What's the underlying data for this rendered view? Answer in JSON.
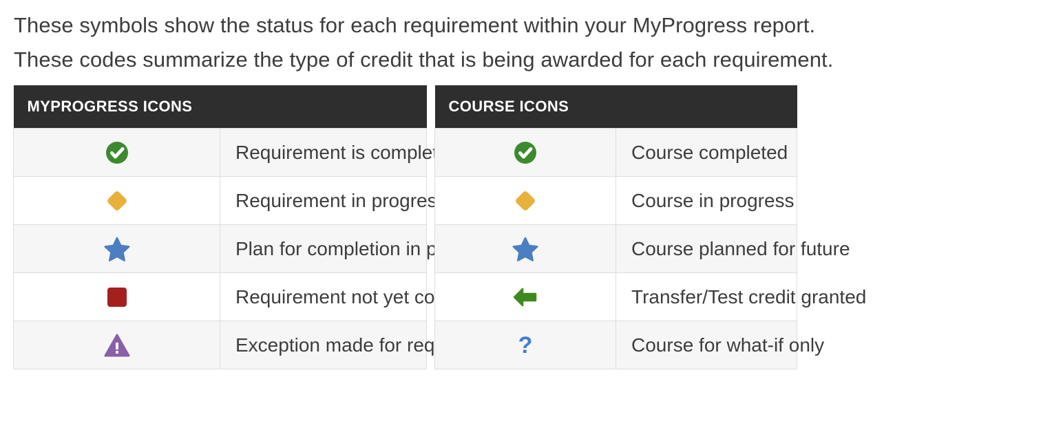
{
  "intro": {
    "line1": "These symbols show the status for each requirement within your MyProgress report.",
    "line2": "These codes summarize the type of credit that is being awarded for each requirement."
  },
  "colors": {
    "header_bg": "#2e2e2e",
    "header_text": "#ffffff",
    "row_alt_bg": "#f6f6f6",
    "row_bg": "#ffffff",
    "border": "#dddddd",
    "body_text": "#3d3d3d",
    "green": "#3b8a2e",
    "gold": "#e8b13c",
    "blue": "#4a7fc1",
    "dark_red": "#a51f1f",
    "purple": "#8a5fa8",
    "arrow_green": "#3f8a1e",
    "question_blue": "#3f7fd0"
  },
  "tables": [
    {
      "id": "myprogress-icons",
      "header": "MYPROGRESS ICONS",
      "rows": [
        {
          "icon": "check-circle-icon",
          "icon_color": "#3b8a2e",
          "label": "Requirement is complete"
        },
        {
          "icon": "diamond-icon",
          "icon_color": "#e8b13c",
          "label": "Requirement in progress"
        },
        {
          "icon": "star-icon",
          "icon_color": "#4a7fc1",
          "label": "Plan for completion in place"
        },
        {
          "icon": "square-icon",
          "icon_color": "#a51f1f",
          "label": "Requirement not yet completed"
        },
        {
          "icon": "warning-triangle-icon",
          "icon_color": "#8a5fa8",
          "label": "Exception made for requirement"
        }
      ]
    },
    {
      "id": "course-icons",
      "header": "COURSE ICONS",
      "rows": [
        {
          "icon": "check-circle-icon",
          "icon_color": "#3b8a2e",
          "label": "Course completed"
        },
        {
          "icon": "diamond-icon",
          "icon_color": "#e8b13c",
          "label": "Course in progress"
        },
        {
          "icon": "star-icon",
          "icon_color": "#4a7fc1",
          "label": "Course planned for future"
        },
        {
          "icon": "arrow-left-icon",
          "icon_color": "#3f8a1e",
          "label": "Transfer/Test credit granted"
        },
        {
          "icon": "question-mark-icon",
          "icon_color": "#3f7fd0",
          "label": "Course for what-if only",
          "glyph": "?"
        }
      ]
    }
  ]
}
